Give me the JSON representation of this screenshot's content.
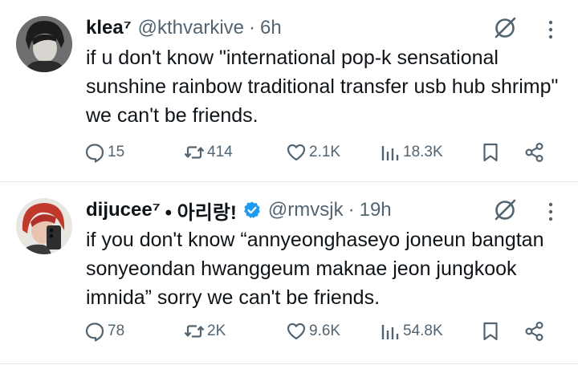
{
  "tweets": [
    {
      "name": "klea⁷",
      "handle": "@kthvarkive",
      "time": "6h",
      "text": "if u don't know \"international pop-k sensational sunshine rainbow traditional transfer usb hub shrimp\" we can't be friends.",
      "replies": "15",
      "reposts": "414",
      "likes": "2.1K",
      "views": "18.3K",
      "verified": false
    },
    {
      "name": "dijucee⁷",
      "name_suffix": "• 아리랑!",
      "handle": "@rmvsjk",
      "time": "19h",
      "text": "if you don't know “annyeonghaseyo joneun bangtan sonyeondan hwanggeum maknae jeon jungkook imnida” sorry we can't be friends.",
      "replies": "78",
      "reposts": "2K",
      "likes": "9.6K",
      "views": "54.8K",
      "verified": true
    }
  ],
  "colors": {
    "text": "#0f1419",
    "muted": "#536471",
    "verified": "#1d9bf0",
    "divider": "#e6e9ec"
  },
  "icons": [
    "grok-icon",
    "more-icon",
    "reply-icon",
    "repost-icon",
    "like-icon",
    "views-icon",
    "bookmark-icon",
    "share-icon",
    "verified-badge-icon"
  ]
}
